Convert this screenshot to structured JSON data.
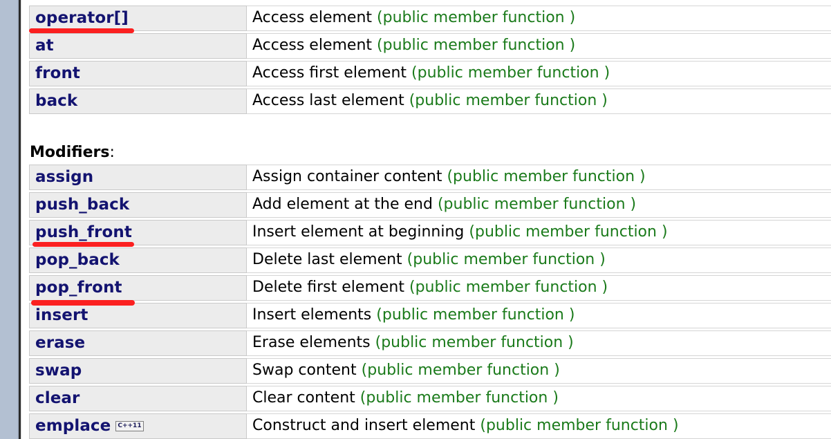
{
  "page": {
    "title": "C++ deque member functions reference",
    "accent_name_color": "#131370",
    "note_color": "#1a7a1a",
    "marker_color": "#fb2020",
    "row_bg": "#ececec"
  },
  "sections": [
    {
      "heading": "",
      "heading_colon": "",
      "rows": [
        {
          "name": "operator[]",
          "badge": "",
          "desc": "Access element",
          "note": "(public member function )"
        },
        {
          "name": "at",
          "badge": "",
          "desc": "Access element",
          "note": "(public member function )"
        },
        {
          "name": "front",
          "badge": "",
          "desc": "Access first element",
          "note": "(public member function )"
        },
        {
          "name": "back",
          "badge": "",
          "desc": "Access last element",
          "note": "(public member function )"
        }
      ]
    },
    {
      "heading": "Modifiers",
      "heading_colon": ":",
      "rows": [
        {
          "name": "assign",
          "badge": "",
          "desc": "Assign container content",
          "note": "(public member function )"
        },
        {
          "name": "push_back",
          "badge": "",
          "desc": "Add element at the end",
          "note": "(public member function )"
        },
        {
          "name": "push_front",
          "badge": "",
          "desc": "Insert element at beginning",
          "note": "(public member function )"
        },
        {
          "name": "pop_back",
          "badge": "",
          "desc": "Delete last element",
          "note": "(public member function )"
        },
        {
          "name": "pop_front",
          "badge": "",
          "desc": "Delete first element",
          "note": "(public member function )"
        },
        {
          "name": "insert",
          "badge": "",
          "desc": "Insert elements",
          "note": "(public member function )"
        },
        {
          "name": "erase",
          "badge": "",
          "desc": "Erase elements",
          "note": "(public member function )"
        },
        {
          "name": "swap",
          "badge": "",
          "desc": "Swap content",
          "note": "(public member function )"
        },
        {
          "name": "clear",
          "badge": "",
          "desc": "Clear content",
          "note": "(public member function )"
        },
        {
          "name": "emplace",
          "badge": "C++11",
          "desc": "Construct and insert element",
          "note": "(public member function )"
        }
      ]
    }
  ],
  "annotations": [
    {
      "target": "operator[]",
      "kind": "red-underline"
    },
    {
      "target": "push_front",
      "kind": "red-underline"
    },
    {
      "target": "pop_front",
      "kind": "red-underline"
    }
  ]
}
